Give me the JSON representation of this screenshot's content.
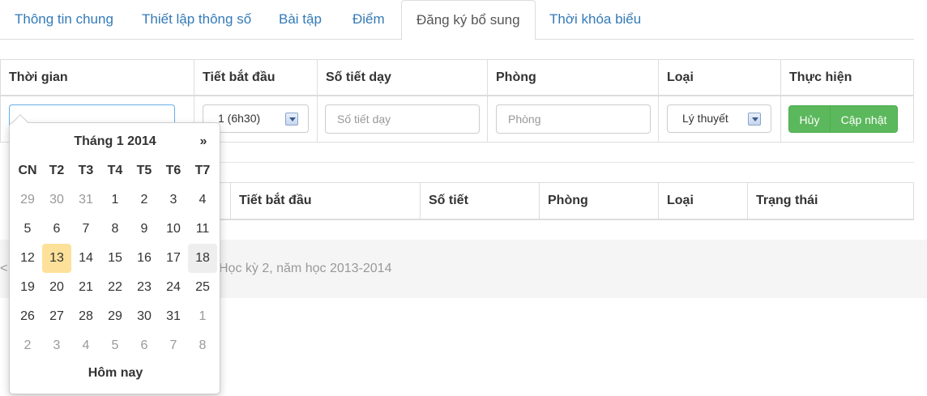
{
  "tabs": [
    {
      "label": "Thông tin chung"
    },
    {
      "label": "Thiết lập thông số"
    },
    {
      "label": "Bài tập"
    },
    {
      "label": "Điểm"
    },
    {
      "label": "Đăng ký bổ sung",
      "active": true
    },
    {
      "label": "Thời khóa biểu"
    }
  ],
  "form_table": {
    "headers": [
      "Thời gian",
      "Tiết bắt đầu",
      "Số tiết dạy",
      "Phòng",
      "Loại",
      "Thực hiện"
    ],
    "time_input": {
      "value": ""
    },
    "start_period": {
      "selected": "1 (6h30)"
    },
    "periods_input": {
      "placeholder": "Số tiết dạy"
    },
    "room_input": {
      "placeholder": "Phòng"
    },
    "type_select": {
      "selected": "Lý thuyết"
    },
    "cancel_label": "Hủy",
    "update_label": "Cập nhật"
  },
  "list_table": {
    "headers": [
      "Tiết bắt đầu",
      "Số tiết",
      "Phòng",
      "Loại",
      "Trạng thái"
    ]
  },
  "footer": {
    "prefix": "<",
    "text": "Học kỳ 2, năm học 2013-2014"
  },
  "datepicker": {
    "title": "Tháng 1 2014",
    "next": "»",
    "dow": [
      "CN",
      "T2",
      "T3",
      "T4",
      "T5",
      "T6",
      "T7"
    ],
    "weeks": [
      [
        "29",
        "30",
        "31",
        "1",
        "2",
        "3",
        "4"
      ],
      [
        "5",
        "6",
        "7",
        "8",
        "9",
        "10",
        "11"
      ],
      [
        "12",
        "13",
        "14",
        "15",
        "16",
        "17",
        "18"
      ],
      [
        "19",
        "20",
        "21",
        "22",
        "23",
        "24",
        "25"
      ],
      [
        "26",
        "27",
        "28",
        "29",
        "30",
        "31",
        "1"
      ],
      [
        "2",
        "3",
        "4",
        "5",
        "6",
        "7",
        "8"
      ]
    ],
    "today_label": "Hôm nay",
    "today_day": "13",
    "highlight_day": "18"
  },
  "colors": {
    "link": "#337ab7",
    "success": "#5cb85c",
    "today_bg": "#fde19a"
  }
}
